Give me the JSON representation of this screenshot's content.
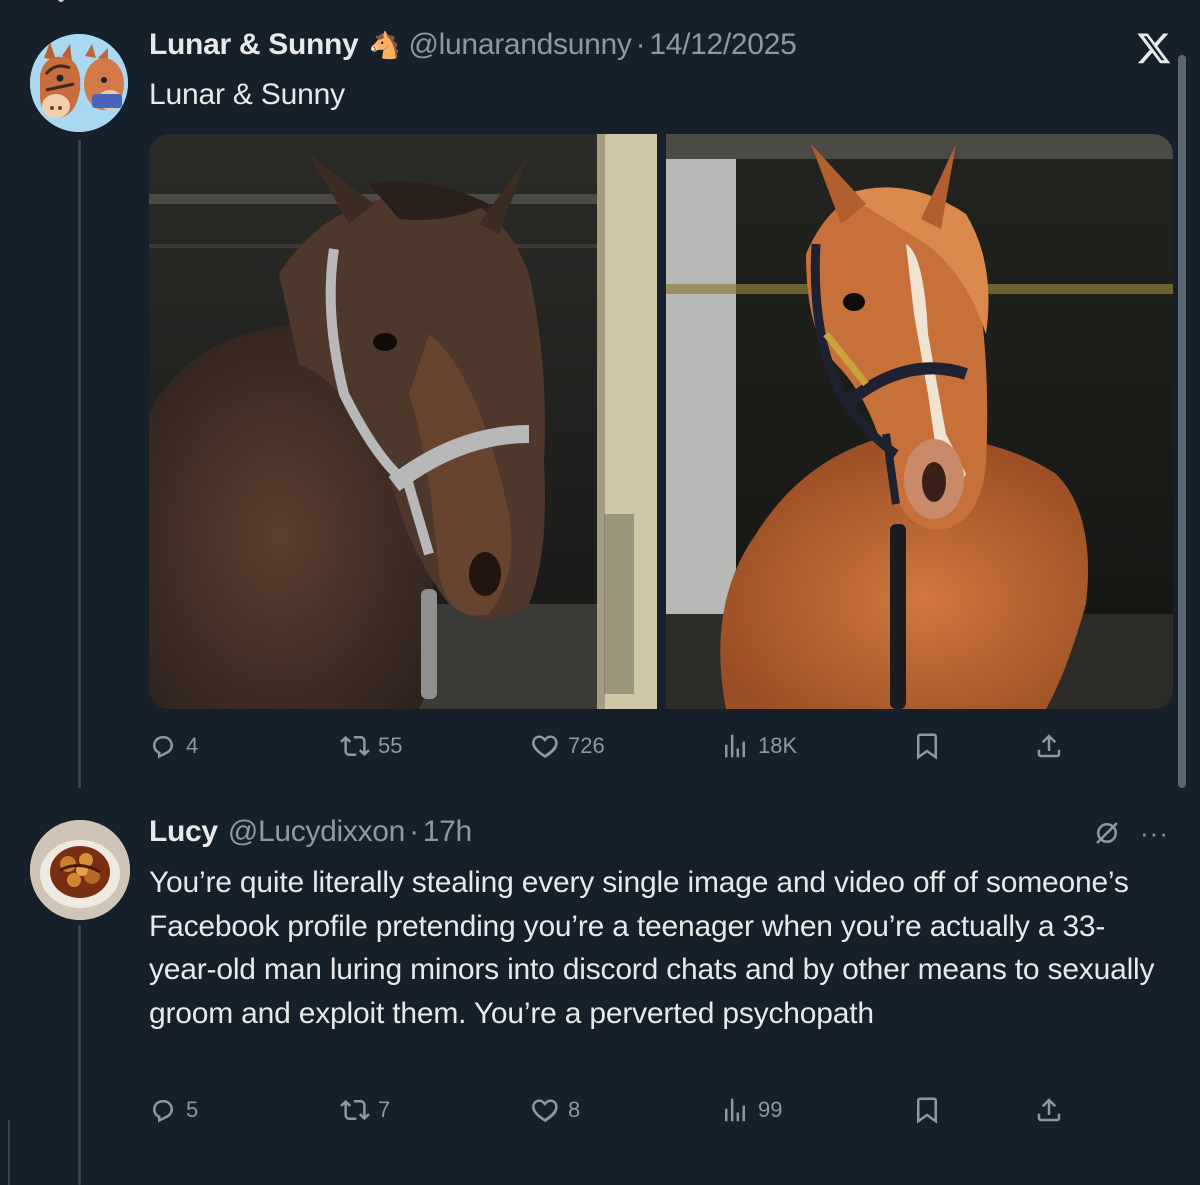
{
  "tweets": [
    {
      "display_name": "Lunar & Sunny",
      "emoji": "🐴",
      "handle": "@lunarandsunny",
      "separator": "·",
      "timestamp": "14/12/2025",
      "text": "Lunar & Sunny",
      "avatar_icon": "cartoon-horses-avatar",
      "media": [
        {
          "description_icon": "bay-horse-photo"
        },
        {
          "description_icon": "chestnut-horse-photo"
        }
      ],
      "stats": {
        "replies": "4",
        "retweets": "55",
        "likes": "726",
        "views": "18K"
      }
    },
    {
      "display_name": "Lucy",
      "handle": "@Lucydixxon",
      "separator": "·",
      "timestamp": "17h",
      "text": "You’re quite literally stealing every single image and video off of someone’s Facebook profile pretending you’re a teenager when you’re actually a 33-year-old man luring minors into discord chats and by other means to sexually groom and exploit them. You’re a perverted psychopath",
      "avatar_icon": "food-plate-avatar",
      "stats": {
        "replies": "5",
        "retweets": "7",
        "likes": "8",
        "views": "99"
      },
      "more_label": "···"
    }
  ],
  "colors": {
    "background": "#15202b",
    "text_primary": "#e7e9ea",
    "text_secondary": "#8b98a5",
    "thread_line": "#38444d"
  },
  "icons": [
    "x-logo-icon",
    "reply-icon",
    "retweet-icon",
    "like-icon",
    "views-icon",
    "bookmark-icon",
    "share-icon",
    "grok-icon",
    "more-icon"
  ]
}
